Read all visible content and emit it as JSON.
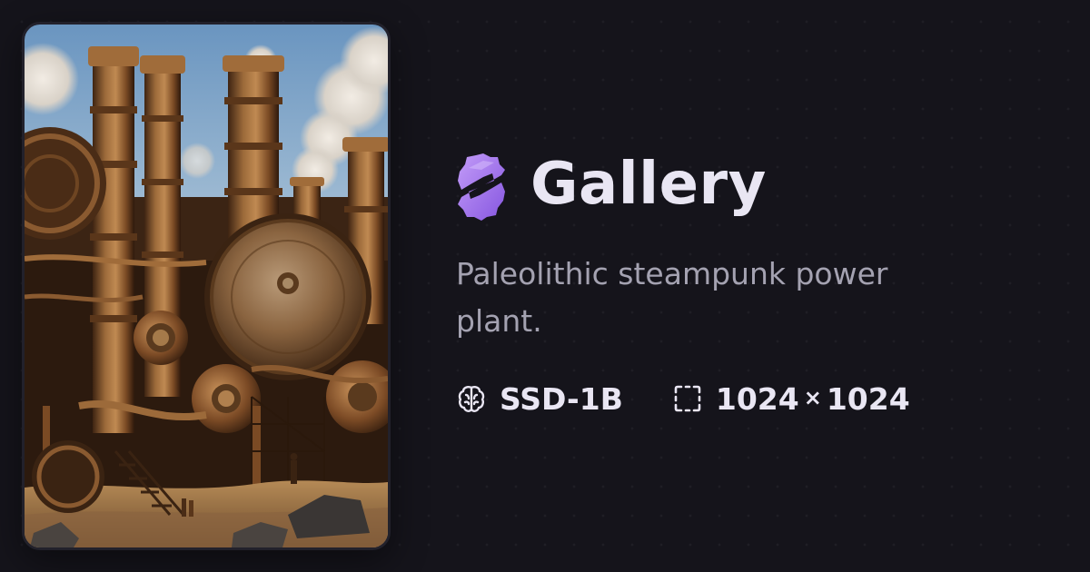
{
  "preview": {
    "image_subject": "steampunk-power-plant"
  },
  "header": {
    "logo_icon": "purple-gear-s-logo-icon",
    "title": "Gallery"
  },
  "prompt": {
    "text": "Paleolithic steampunk power plant."
  },
  "meta": {
    "model": {
      "icon": "brain-icon",
      "label": "SSD-1B"
    },
    "size": {
      "icon": "dashed-frame-icon",
      "width": "1024",
      "times": "×",
      "height": "1024"
    }
  },
  "colors": {
    "background": "#15141b",
    "title": "#e9e6f3",
    "description": "#a4a2b1",
    "accent": "#a97cf2"
  }
}
